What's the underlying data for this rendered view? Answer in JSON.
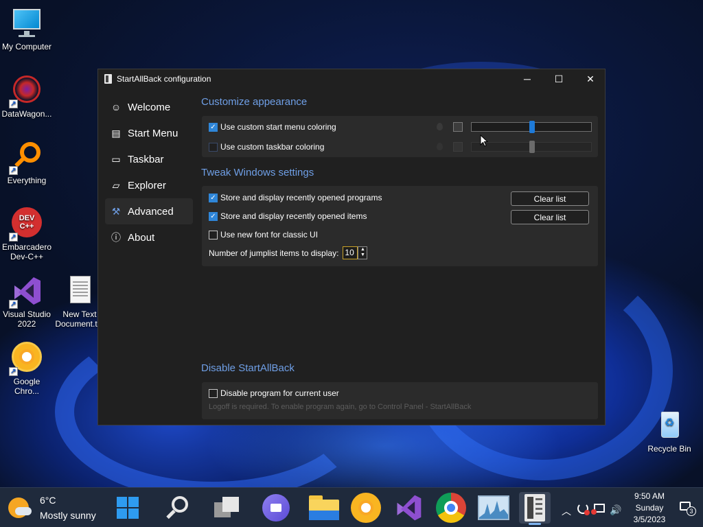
{
  "desktop": {
    "icons": [
      {
        "label": "My Computer",
        "icon": "monitor-icon"
      },
      {
        "label": "DataWagon...",
        "icon": "datawagon-icon"
      },
      {
        "label": "Everything",
        "icon": "magnifier-orange-icon"
      },
      {
        "label": "Embarcadero Dev-C++",
        "icon": "devcpp-icon",
        "badge": "DEV C++"
      },
      {
        "label": "Visual Studio 2022",
        "icon": "visual-studio-icon"
      },
      {
        "label": "New Text Document.t...",
        "icon": "text-document-icon"
      },
      {
        "label": "Google Chro...",
        "icon": "chrome-canary-icon"
      },
      {
        "label": "Recycle Bin",
        "icon": "recycle-bin-icon"
      }
    ]
  },
  "window": {
    "title": "StartAllBack configuration",
    "controls": {
      "minimize": "─",
      "maximize": "☐",
      "close": "✕"
    },
    "nav": [
      {
        "label": "Welcome",
        "icon": "smile-icon",
        "glyph": "☺"
      },
      {
        "label": "Start Menu",
        "icon": "start-menu-icon",
        "glyph": "▤"
      },
      {
        "label": "Taskbar",
        "icon": "taskbar-icon",
        "glyph": "▭"
      },
      {
        "label": "Explorer",
        "icon": "folder-icon",
        "glyph": "▱"
      },
      {
        "label": "Advanced",
        "icon": "wrench-icon",
        "glyph": "⚒"
      },
      {
        "label": "About",
        "icon": "info-icon",
        "glyph": "ⓘ"
      }
    ],
    "selected_nav": "Advanced",
    "appearance": {
      "title": "Customize appearance",
      "start_menu_coloring": {
        "label": "Use custom start menu coloring",
        "checked": true
      },
      "taskbar_coloring": {
        "label": "Use custom taskbar coloring",
        "checked": false
      },
      "accent": "#1e7ad8"
    },
    "tweak": {
      "title": "Tweak Windows settings",
      "recent_programs": {
        "label": "Store and display recently opened programs",
        "checked": true
      },
      "recent_items": {
        "label": "Store and display recently opened items",
        "checked": true
      },
      "new_font": {
        "label": "Use new font for classic UI",
        "checked": false
      },
      "clear_label": "Clear list",
      "jumplist_label": "Number of jumplist items to display:",
      "jumplist_value": "10"
    },
    "disable": {
      "title": "Disable StartAllBack",
      "checkbox": {
        "label": "Disable program for current user",
        "checked": false
      },
      "hint": "Logoff is required. To enable program again, go to Control Panel - StartAllBack"
    }
  },
  "taskbar": {
    "weather": {
      "temp": "6°C",
      "desc": "Mostly sunny"
    },
    "apps": [
      "start-icon",
      "search-icon",
      "task-view-icon",
      "chat-icon",
      "file-explorer-icon",
      "chrome-canary-icon",
      "visual-studio-icon",
      "chrome-icon",
      "resource-monitor-icon",
      "startallback-icon"
    ],
    "clock": {
      "time": "9:50 AM",
      "day": "Sunday",
      "date": "3/5/2023"
    },
    "notifications": "3"
  }
}
